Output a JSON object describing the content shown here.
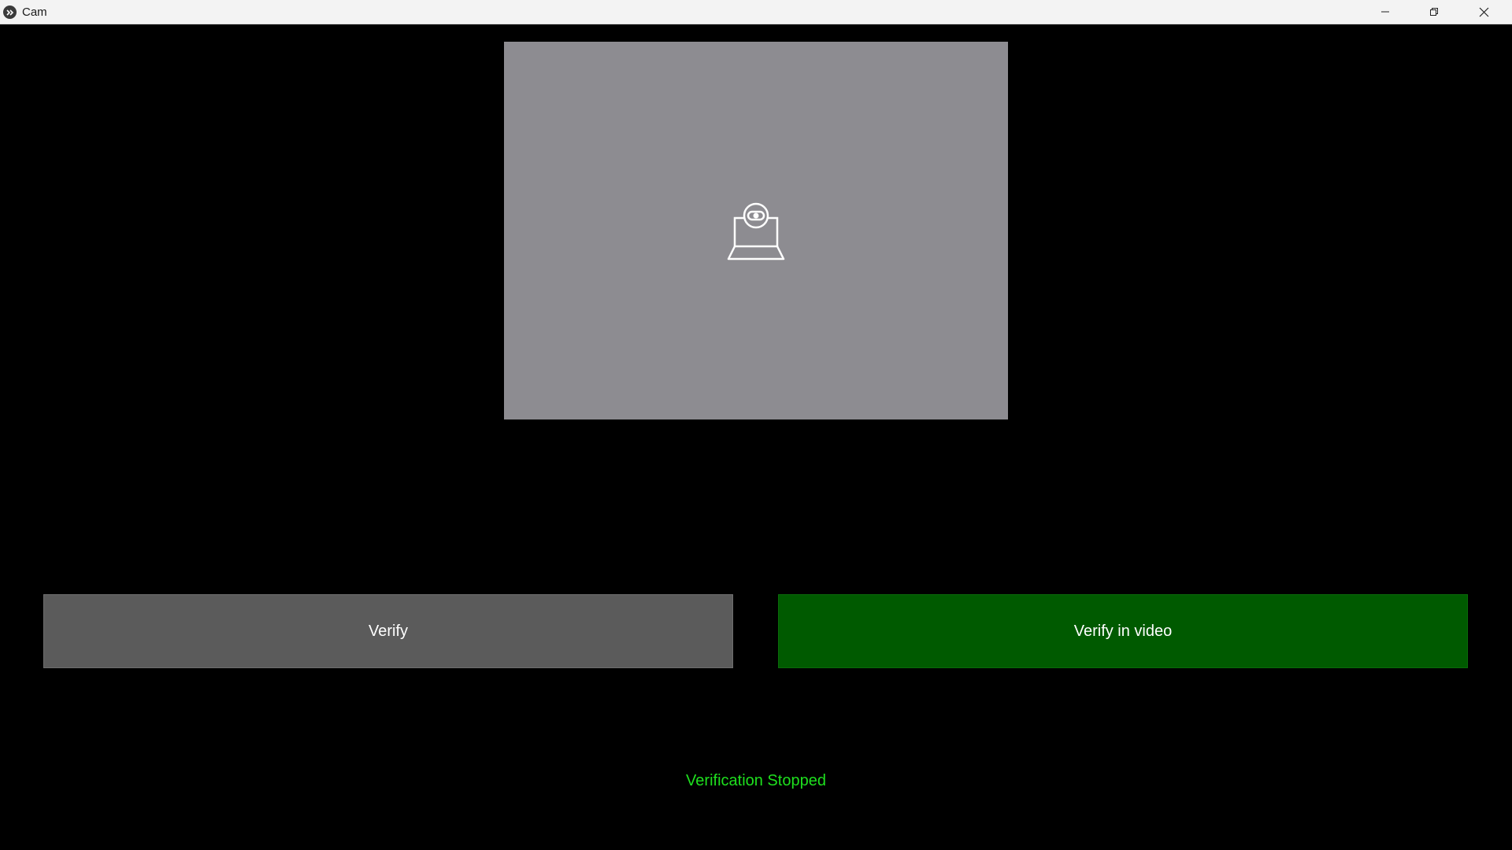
{
  "window": {
    "title": "Cam",
    "app_icon": "kivy-logo-icon",
    "controls": {
      "minimize_icon": "minimize-icon",
      "maximize_icon": "restore-icon",
      "close_icon": "close-icon"
    }
  },
  "camera": {
    "icon": "webcam-icon",
    "background_color": "#8d8c91"
  },
  "buttons": {
    "verify_label": "Verify",
    "verify_color": "#5b5b5b",
    "verify_video_label": "Verify in video",
    "verify_video_color": "#005a00"
  },
  "status": {
    "text": "Verification Stopped",
    "color": "#1ee01e"
  }
}
